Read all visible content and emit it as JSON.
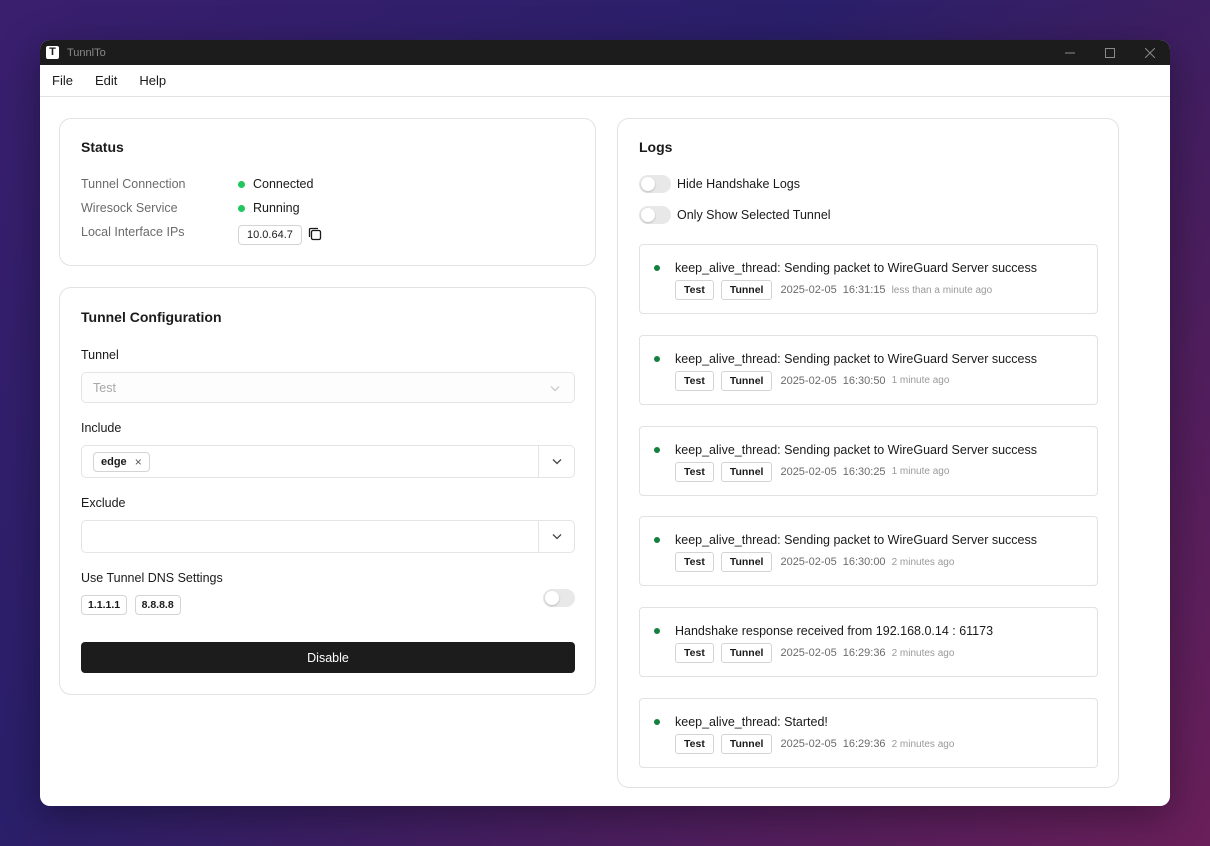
{
  "window": {
    "title": "TunnlTo",
    "logo_letter": "T"
  },
  "menu": {
    "file": "File",
    "edit": "Edit",
    "help": "Help"
  },
  "status": {
    "title": "Status",
    "tunnel_connection_label": "Tunnel Connection",
    "tunnel_connection_value": "Connected",
    "wiresock_label": "Wiresock Service",
    "wiresock_value": "Running",
    "local_ips_label": "Local Interface IPs",
    "local_ip": "10.0.64.7"
  },
  "config": {
    "title": "Tunnel Configuration",
    "tunnel_label": "Tunnel",
    "tunnel_value": "Test",
    "include_label": "Include",
    "include_tags": [
      "edge"
    ],
    "exclude_label": "Exclude",
    "dns_label": "Use Tunnel DNS Settings",
    "dns_servers": [
      "1.1.1.1",
      "8.8.8.8"
    ],
    "disable_button": "Disable"
  },
  "logs": {
    "title": "Logs",
    "hide_handshake_label": "Hide Handshake Logs",
    "only_selected_label": "Only Show Selected Tunnel",
    "entries": [
      {
        "message": "keep_alive_thread: Sending packet to WireGuard Server success",
        "tag1": "Test",
        "tag2": "Tunnel",
        "date": "2025-02-05",
        "time": "16:31:15",
        "ago": "less than a minute ago"
      },
      {
        "message": "keep_alive_thread: Sending packet to WireGuard Server success",
        "tag1": "Test",
        "tag2": "Tunnel",
        "date": "2025-02-05",
        "time": "16:30:50",
        "ago": "1 minute ago"
      },
      {
        "message": "keep_alive_thread: Sending packet to WireGuard Server success",
        "tag1": "Test",
        "tag2": "Tunnel",
        "date": "2025-02-05",
        "time": "16:30:25",
        "ago": "1 minute ago"
      },
      {
        "message": "keep_alive_thread: Sending packet to WireGuard Server success",
        "tag1": "Test",
        "tag2": "Tunnel",
        "date": "2025-02-05",
        "time": "16:30:00",
        "ago": "2 minutes ago"
      },
      {
        "message": "Handshake response received from 192.168.0.14 : 61173",
        "tag1": "Test",
        "tag2": "Tunnel",
        "date": "2025-02-05",
        "time": "16:29:36",
        "ago": "2 minutes ago"
      },
      {
        "message": "keep_alive_thread: Started!",
        "tag1": "Test",
        "tag2": "Tunnel",
        "date": "2025-02-05",
        "time": "16:29:36",
        "ago": "2 minutes ago"
      }
    ]
  },
  "colors": {
    "accent": "#1c1c1c",
    "status_green": "#22c55e",
    "log_dot": "#15803d"
  }
}
